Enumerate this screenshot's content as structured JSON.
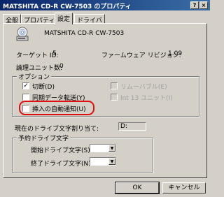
{
  "window": {
    "title": "MATSHITA CD-R  CW-7503 のプロパティ",
    "help_btn": "?",
    "close_btn": "×"
  },
  "tabs": [
    "全般",
    "プロパティ",
    "設定",
    "ドライバ"
  ],
  "device": {
    "icon": "cd-drive-icon",
    "name": "MATSHITA CD-R   CW-7503"
  },
  "info": {
    "target_id_label": "ターゲット ID:",
    "target_id_value": "5",
    "firmware_label": "ファームウェア リビジョン:",
    "firmware_value": "1.09",
    "lun_label": "論理ユニット数:",
    "lun_value": "0"
  },
  "options": {
    "legend": "オプション",
    "disconnect": "切断(D)",
    "disconnect_mark": "✓",
    "removable": "リムーバブル(E)",
    "sync": "同期データ転送(Y)",
    "int13": "Int 13 ユニット(I)",
    "auto_insert": "挿入の自動通知(U)"
  },
  "drive_letter": {
    "current_label": "現在のドライブ文字割り当て:",
    "current_value": "D:",
    "reserved_legend": "予約ドライブ文字",
    "start_label": "開始ドライブ文字(S):",
    "end_label": "終了ドライブ文字(N):"
  },
  "buttons": {
    "ok": "OK",
    "cancel": "キャンセル"
  },
  "colors": {
    "highlight": "#e01010",
    "titlebar": "#0a246a"
  }
}
